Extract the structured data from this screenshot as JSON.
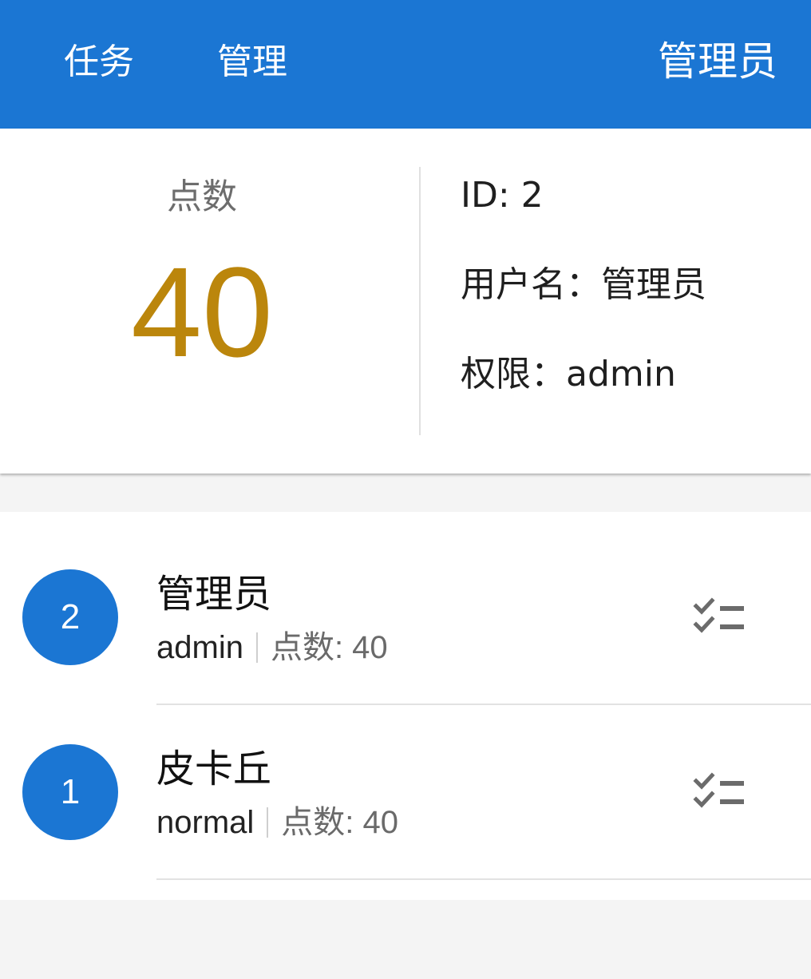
{
  "nav": {
    "tasks_label": "任务",
    "manage_label": "管理",
    "current_user": "管理员"
  },
  "profile": {
    "points_label": "点数",
    "points_value": "40",
    "id_line": "ID: 2",
    "username_line": "用户名：管理员",
    "role_line": "权限：admin"
  },
  "users": [
    {
      "avatar": "2",
      "name": "管理员",
      "role": "admin",
      "points": "点数: 40",
      "action_icon": "checklist-icon"
    },
    {
      "avatar": "1",
      "name": "皮卡丘",
      "role": "normal",
      "points": "点数: 40",
      "action_icon": "checklist-icon"
    }
  ],
  "colors": {
    "primary": "#1b76d3",
    "points_accent": "#bb860c",
    "background": "#f4f4f4"
  }
}
